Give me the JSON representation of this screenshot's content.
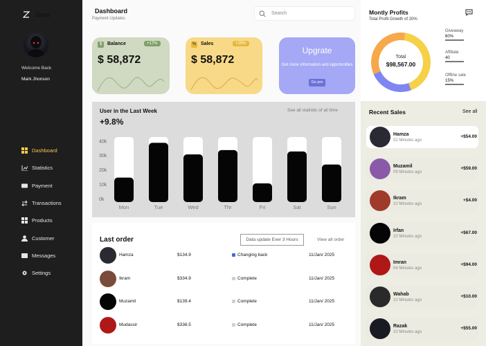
{
  "brand": {
    "name": "Zarss"
  },
  "user": {
    "welcome": "Welcome Back",
    "name": "Mark Jhonson"
  },
  "nav": [
    {
      "label": "Dashboard",
      "icon": "grid-icon",
      "active": true
    },
    {
      "label": "Statistics",
      "icon": "chart-icon"
    },
    {
      "label": "Payment",
      "icon": "card-icon"
    },
    {
      "label": "Transactions",
      "icon": "swap-icon"
    },
    {
      "label": "Products",
      "icon": "box-icon"
    },
    {
      "label": "Customer",
      "icon": "user-icon"
    },
    {
      "label": "Messages",
      "icon": "message-icon"
    },
    {
      "label": "Settings",
      "icon": "gear-icon"
    }
  ],
  "header": {
    "title": "Dashboard",
    "subtitle": "Payment Updates",
    "search_placeholder": "Search"
  },
  "cards": {
    "balance": {
      "icon": "$",
      "title": "Balance",
      "badge": "+17%",
      "amount": "$ 58,872",
      "color": "#d0d9c1"
    },
    "sales": {
      "icon": "%",
      "title": "Sales",
      "badge": "+25%",
      "amount": "$ 58,872",
      "color": "#f8d987"
    },
    "upgrade": {
      "title": "Upgrate",
      "text": "Get more information and opprrtunities",
      "button": "Go pro",
      "color": "#a4a8f5"
    }
  },
  "weekly": {
    "title": "User in the Last Week",
    "link": "See all statistic of all time",
    "growth": "+9.8%"
  },
  "chart_data": {
    "type": "bar",
    "categories": [
      "Mon",
      "Tue",
      "Wed",
      "Thr",
      "Fri",
      "Sat",
      "Sun"
    ],
    "values": [
      15,
      39,
      31,
      34,
      11,
      33,
      24
    ],
    "ylim": [
      0,
      43
    ],
    "yticks": [
      "40k",
      "30k",
      "20k",
      "10k",
      "0k"
    ],
    "ytick_values": [
      40,
      30,
      20,
      10,
      0
    ]
  },
  "orders": {
    "title": "Last order",
    "update_label": "Data update Ever 3 Hours",
    "view_all": "View all order",
    "rows": [
      {
        "name": "Hamza",
        "amount": "$134.9",
        "status": "Changing back",
        "status_color": "#3b6de0",
        "date": "11/Jan/ 2025",
        "avatar": "#2a2a33"
      },
      {
        "name": "Ikram",
        "amount": "$334.9",
        "status": "Complete",
        "status_color": "#cfcfcf",
        "date": "11/Jan/ 2025",
        "avatar": "#7a4a3a"
      },
      {
        "name": "Muzamil",
        "amount": "$139.4",
        "status": "Complete",
        "status_color": "#cfcfcf",
        "date": "11/Jan/ 2025",
        "avatar": "#050505"
      },
      {
        "name": "Mudassir",
        "amount": "$336.5",
        "status": "Complete",
        "status_color": "#cfcfcf",
        "date": "11/Jan/ 2025",
        "avatar": "#b01818"
      }
    ]
  },
  "profits": {
    "title": "Montly Profits",
    "subtitle": "Total Profit Growth of 20%",
    "total_label": "Total",
    "total_value": "$98,567.00",
    "segments": [
      {
        "label": "Giveaway",
        "value": "60%",
        "color": "#f6d046",
        "fraction": 0.42
      },
      {
        "label": "Affiliate",
        "value": "40",
        "color": "#7f86f2",
        "fraction": 0.24
      },
      {
        "label": "Offline sale",
        "value": "15%",
        "color": "#f6a84a",
        "fraction": 0.34
      }
    ]
  },
  "recent_sales": {
    "title": "Recent Sales",
    "see_all": "See all",
    "items": [
      {
        "name": "Hamza",
        "time": "02 Minutes ago",
        "amount": "+$54.00",
        "avatar": "#2a2a33"
      },
      {
        "name": "Muzamil",
        "time": "09 Minutes ago",
        "amount": "+$59.00",
        "avatar": "#8a5aa8"
      },
      {
        "name": "Ikram",
        "time": "10 Minutes ago",
        "amount": "+$4.00",
        "avatar": "#a03a2a"
      },
      {
        "name": "Irfan",
        "time": "10 Minutes ago",
        "amount": "+$67.00",
        "avatar": "#050505"
      },
      {
        "name": "Imran",
        "time": "04 Minutes ago",
        "amount": "+$94.00",
        "avatar": "#b01818"
      },
      {
        "name": "Wahab",
        "time": "10 Minutes ago",
        "amount": "+$10.00",
        "avatar": "#2a2a2a"
      },
      {
        "name": "Razak",
        "time": "10 Minutes ago",
        "amount": "+$55.00",
        "avatar": "#1a1a22"
      }
    ]
  }
}
